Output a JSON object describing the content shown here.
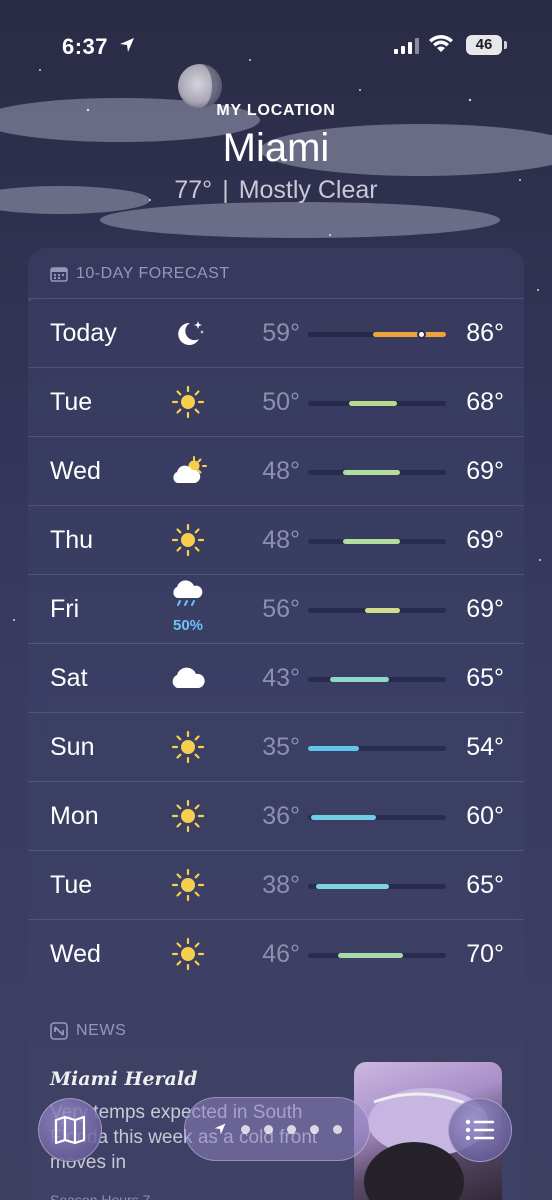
{
  "status_bar": {
    "time": "6:37",
    "battery": "46"
  },
  "header": {
    "location_label": "MY LOCATION",
    "city": "Miami",
    "temperature": "77°",
    "separator": "|",
    "condition": "Mostly Clear"
  },
  "forecast": {
    "title": "10-DAY FORECAST",
    "title_icon": "calendar-icon",
    "scale": {
      "min": 35,
      "max": 86
    },
    "days": [
      {
        "day": "Today",
        "icon": "moon-stars-icon",
        "low": "59°",
        "high": "86°",
        "low_val": 59,
        "high_val": 86,
        "current_val": 77,
        "bar_color": "#f0a23a",
        "precip": ""
      },
      {
        "day": "Tue",
        "icon": "sun-icon",
        "low": "50°",
        "high": "68°",
        "low_val": 50,
        "high_val": 68,
        "bar_color": "#b9d98f",
        "precip": ""
      },
      {
        "day": "Wed",
        "icon": "partly-cloudy-icon",
        "low": "48°",
        "high": "69°",
        "low_val": 48,
        "high_val": 69,
        "bar_color": "#b3dca0",
        "precip": ""
      },
      {
        "day": "Thu",
        "icon": "sun-icon",
        "low": "48°",
        "high": "69°",
        "low_val": 48,
        "high_val": 69,
        "bar_color": "#b3dca0",
        "precip": ""
      },
      {
        "day": "Fri",
        "icon": "rain-cloud-icon",
        "low": "56°",
        "high": "69°",
        "low_val": 56,
        "high_val": 69,
        "bar_color": "#d3dc8c",
        "precip": "50%"
      },
      {
        "day": "Sat",
        "icon": "cloud-icon",
        "low": "43°",
        "high": "65°",
        "low_val": 43,
        "high_val": 65,
        "bar_color": "#8fd7c7",
        "precip": ""
      },
      {
        "day": "Sun",
        "icon": "sun-icon",
        "low": "35°",
        "high": "54°",
        "low_val": 35,
        "high_val": 54,
        "bar_color": "#63c4ef",
        "precip": ""
      },
      {
        "day": "Mon",
        "icon": "sun-icon",
        "low": "36°",
        "high": "60°",
        "low_val": 36,
        "high_val": 60,
        "bar_color": "#72cde6",
        "precip": ""
      },
      {
        "day": "Tue",
        "icon": "sun-icon",
        "low": "38°",
        "high": "65°",
        "low_val": 38,
        "high_val": 65,
        "bar_color": "#7dd4da",
        "precip": ""
      },
      {
        "day": "Wed",
        "icon": "sun-icon",
        "low": "46°",
        "high": "70°",
        "low_val": 46,
        "high_val": 70,
        "bar_color": "#a5dbaa",
        "precip": ""
      }
    ]
  },
  "news": {
    "title": "NEWS",
    "source": "Miami Herald",
    "headline": "Very temps expected in South Florida this week as a cold front moves in",
    "meta": "Season Hours 7"
  },
  "toolbar": {
    "map_icon": "map-icon",
    "list_icon": "list-icon",
    "page_count": 5
  }
}
